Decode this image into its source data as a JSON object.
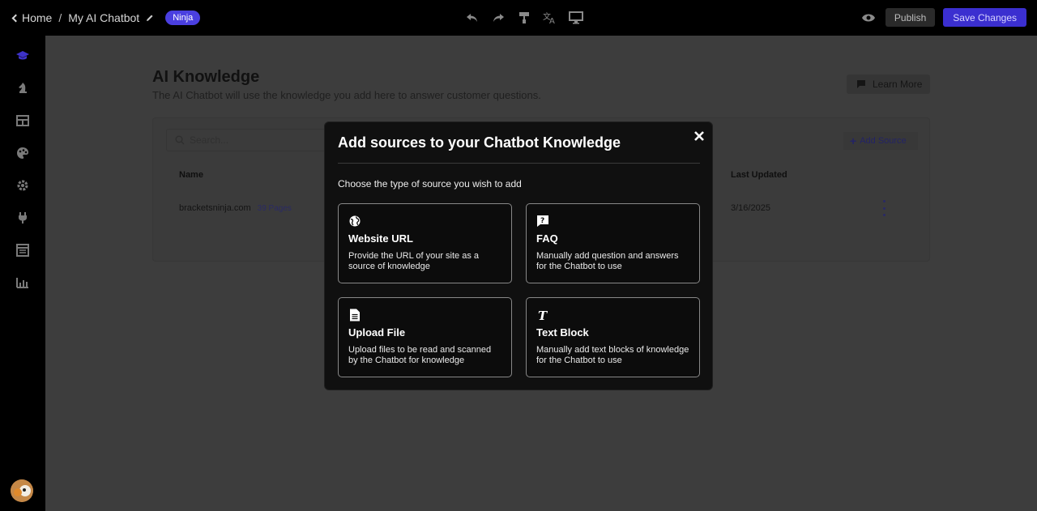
{
  "topbar": {
    "home_label": "Home",
    "separator": "/",
    "app_name": "My AI Chatbot",
    "badge": "Ninja",
    "publish_label": "Publish",
    "save_label": "Save Changes"
  },
  "page": {
    "title": "AI Knowledge",
    "subtitle": "The AI Chatbot will use the knowledge you add here to answer customer questions.",
    "learn_more": "Learn More"
  },
  "table": {
    "search_placeholder": "Search...",
    "add_source_label": "Add Source",
    "columns": {
      "name": "Name",
      "last_updated": "Last Updated"
    },
    "rows": [
      {
        "name": "bracketsninja.com",
        "pages": "39 Pages",
        "updated": "3/16/2025"
      }
    ]
  },
  "modal": {
    "title": "Add sources to your Chatbot Knowledge",
    "instruction": "Choose the type of source you wish to add",
    "options": [
      {
        "icon": "globe-icon",
        "title": "Website URL",
        "desc": "Provide the URL of your site as a source of knowledge"
      },
      {
        "icon": "faq-icon",
        "title": "FAQ",
        "desc": "Manually add question and answers for the Chatbot to use"
      },
      {
        "icon": "file-icon",
        "title": "Upload File",
        "desc": "Upload files to be read and scanned by the Chatbot for knowledge"
      },
      {
        "icon": "text-icon",
        "title": "Text Block",
        "desc": "Manually add text blocks of knowledge for the Chatbot to use"
      }
    ]
  },
  "colors": {
    "accent": "#3b2fd0",
    "badge": "#4a3fe0",
    "overlay": "#3d3d3d",
    "modal_bg": "#101010"
  }
}
